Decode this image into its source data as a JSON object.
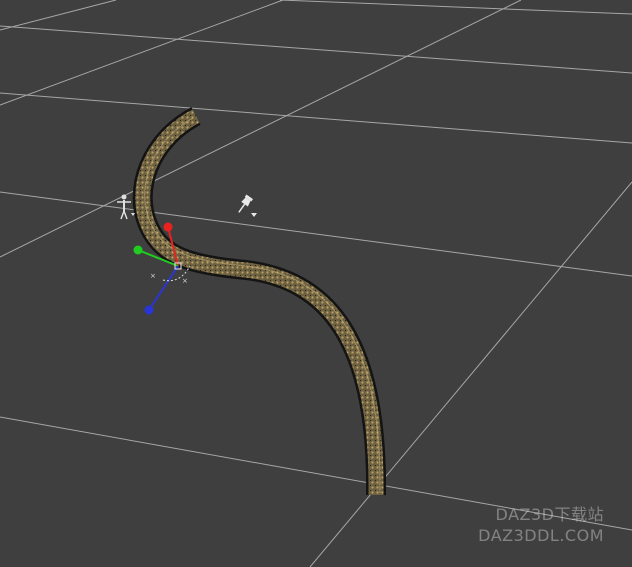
{
  "viewport": {
    "background": "#3f3f3f",
    "grid_color": "#b9b9b9",
    "object": {
      "type": "curved-tube",
      "fill_color": "#6e6142",
      "pattern_color": "#b9a064",
      "outline_color": "#141414"
    },
    "gizmo": {
      "x_axis_color": "#e8231f",
      "y_axis_color": "#1fcc1f",
      "z_axis_color": "#2a35d6"
    },
    "icons": [
      "figure-pose-icon",
      "pin-icon"
    ]
  },
  "watermark": {
    "line1": "DAZ3D下载站",
    "line2": "DAZ3DDL.COM"
  }
}
